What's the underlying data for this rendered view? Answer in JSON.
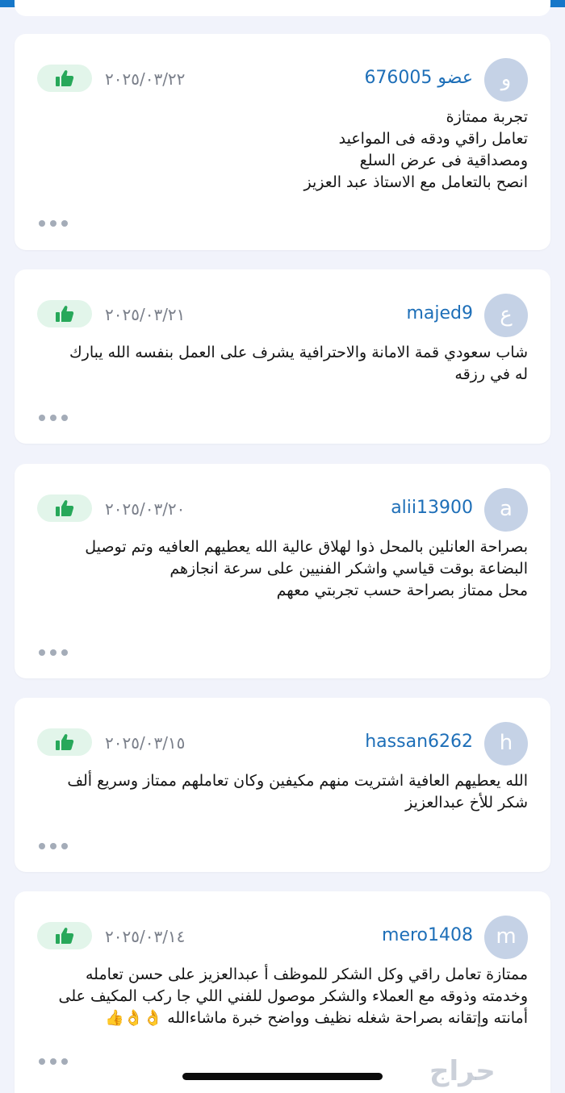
{
  "reviews": [
    {
      "avatar_letter": "و",
      "username": "عضو 676005",
      "date": "٢٠٢٥/٠٣/٢٢",
      "text": "تجربة ممتازة\nتعامل راقي ودقه فى المواعيد\nومصداقية فى عرض السلع\nانصح بالتعامل مع الاستاذ عبد العزيز",
      "liked": true
    },
    {
      "avatar_letter": "ع",
      "username": "majed9",
      "date": "٢٠٢٥/٠٣/٢١",
      "text": "شاب سعودي قمة الامانة والاحترافية   يشرف على العمل بنفسه   الله يبارك\nله في رزقه",
      "liked": true
    },
    {
      "avatar_letter": "a",
      "username": "alii13900",
      "date": "٢٠٢٥/٠٣/٢٠",
      "text": "بصراحة  العانلين بالمحل  ذوا لهلاق عالية الله يعطيهم العافيه  وتم توصيل\nالبضاعة بوقت قياسي واشكر الفنيين على سرعة انجازهم\nمحل ممتاز  بصراحة حسب تجربتي معهم",
      "liked": true
    },
    {
      "avatar_letter": "h",
      "username": "hassan6262",
      "date": "٢٠٢٥/٠٣/١٥",
      "text": "الله يعطيهم العافية اشتريت منهم مكيفين وكان تعاملهم ممتاز وسريع ألف\nشكر للأخ  عبدالعزيز",
      "liked": true
    },
    {
      "avatar_letter": "m",
      "username": "mero1408",
      "date": "٢٠٢٥/٠٣/١٤",
      "text": "ممتازة تعامل راقي وكل الشكر للموظف أ  عبدالعزيز على حسن تعامله\nوخدمته وذوقه مع العملاء والشكر موصول للفني اللي جا ركب المكيف على\nأمانته وإتقانه بصراحة شغله نظيف وواضح خبرة ماشاءالله 👌👌👍",
      "liked": true
    }
  ],
  "icons": {
    "like": "thumbs-up-icon",
    "more": "more-dots-icon"
  },
  "colors": {
    "accent": "#1677c9",
    "username": "#1e6fb8",
    "like_badge_bg": "#e2f5ea",
    "like_icon": "#27a85a"
  },
  "watermark": "حراج"
}
